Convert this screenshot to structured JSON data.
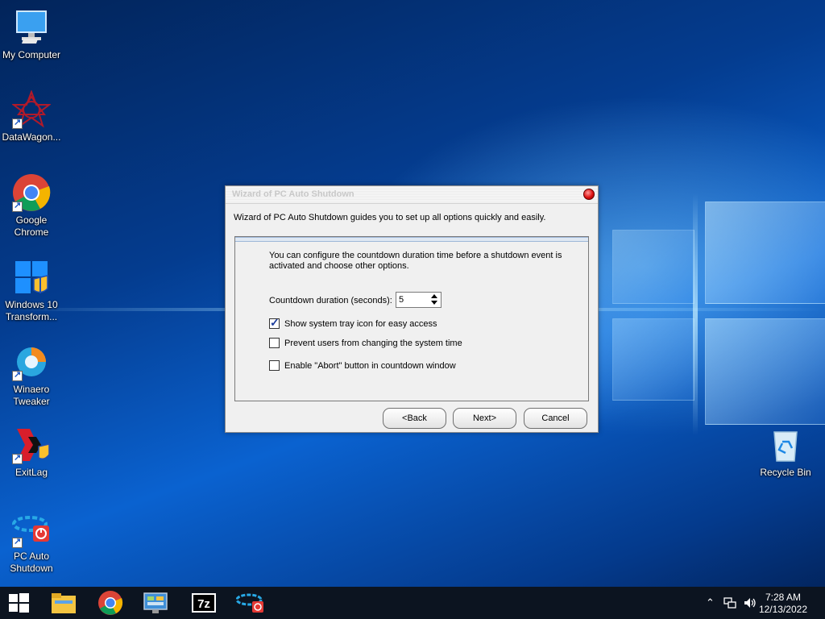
{
  "desktop": {
    "icons": [
      {
        "label": "My Computer"
      },
      {
        "label": "DataWagon..."
      },
      {
        "label": "Google Chrome"
      },
      {
        "label": "Windows 10 Transform..."
      },
      {
        "label": "Winaero Tweaker"
      },
      {
        "label": "ExitLag"
      },
      {
        "label": "PC Auto Shutdown"
      },
      {
        "label": "Recycle Bin"
      }
    ]
  },
  "dialog": {
    "title": "Wizard of PC Auto Shutdown",
    "intro": "Wizard of PC Auto Shutdown guides you to set up all options quickly and easily.",
    "description": "You can configure the countdown duration time before a shutdown event is activated and choose other options.",
    "countdown_label": "Countdown duration (seconds):",
    "countdown_value": "5",
    "options": [
      {
        "label": "Show system tray icon for easy access",
        "checked": true
      },
      {
        "label": "Prevent users from changing the system time",
        "checked": false
      },
      {
        "label": "Enable \"Abort\" button in countdown window",
        "checked": false
      }
    ],
    "buttons": {
      "back": "<Back",
      "next": "Next>",
      "cancel": "Cancel"
    }
  },
  "taskbar": {
    "clock_time": "7:28 AM",
    "clock_date": "12/13/2022",
    "pinned": [
      "start-icon",
      "file-explorer-icon",
      "chrome-icon",
      "control-panel-icon",
      "7zip-icon",
      "pc-auto-shutdown-icon"
    ],
    "tray": [
      "chevron-up-icon",
      "network-icon",
      "volume-icon"
    ]
  }
}
